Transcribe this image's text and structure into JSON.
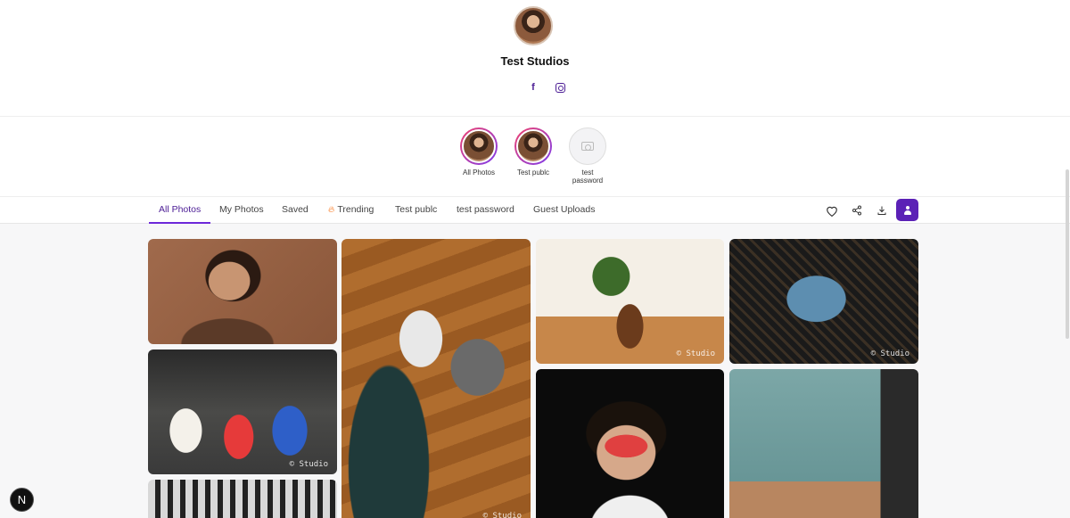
{
  "profile": {
    "name": "Test Studios"
  },
  "albums": [
    {
      "label": "All Photos",
      "has_cover": true
    },
    {
      "label": "Test publc",
      "has_cover": true
    },
    {
      "label": "test password",
      "has_cover": false
    }
  ],
  "tabs": [
    {
      "label": "All Photos",
      "active": true
    },
    {
      "label": "My Photos"
    },
    {
      "label": "Saved"
    },
    {
      "label": "Trending",
      "icon": "fire-icon"
    },
    {
      "label": "Test publc"
    },
    {
      "label": "test password"
    },
    {
      "label": "Guest Uploads"
    }
  ],
  "toolbar": {
    "icons": [
      "heart-icon",
      "share-icon",
      "download-icon",
      "user-icon"
    ],
    "accent_color": "#5b21b6"
  },
  "gallery": {
    "watermark": "© Studio"
  },
  "floating_badge": "N"
}
